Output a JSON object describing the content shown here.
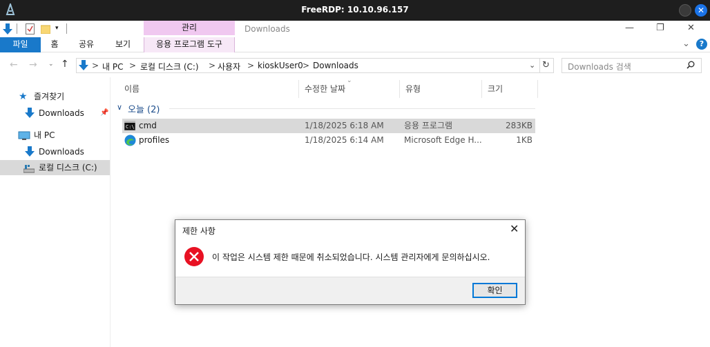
{
  "rdp": {
    "title": "FreeRDP: 10.10.96.157",
    "logo_icon": "freerdp-logo-icon"
  },
  "window": {
    "title": "Downloads",
    "context_group": "관리",
    "ribbon_tabs": [
      "파일",
      "홈",
      "공유",
      "보기",
      "응용 프로그램 도구"
    ],
    "minimize_glyph": "—",
    "maximize_glyph": "❐",
    "close_glyph": "✕",
    "expand_glyph": "⌄",
    "help_glyph": "?"
  },
  "address": {
    "path": [
      "내 PC",
      "로컬 디스크 (C:)",
      "사용자",
      "kioskUser0",
      "Downloads"
    ],
    "separator": ">",
    "search_placeholder": "Downloads 검색"
  },
  "nav": {
    "favorites": "즐겨찾기",
    "fav_downloads": "Downloads",
    "this_pc": "내 PC",
    "pc_downloads": "Downloads",
    "local_disk": "로컬 디스크 (C:)"
  },
  "columns": {
    "name": "이름",
    "modified": "수정한 날짜",
    "type": "유형",
    "size": "크기"
  },
  "group": {
    "label": "오늘 (2)"
  },
  "files": [
    {
      "name": "cmd",
      "modified": "1/18/2025 6:18 AM",
      "type": "응용 프로그램",
      "size": "283KB",
      "icon": "cmd-icon"
    },
    {
      "name": "profiles",
      "modified": "1/18/2025 6:14 AM",
      "type": "Microsoft Edge H...",
      "size": "1KB",
      "icon": "edge-icon"
    }
  ],
  "dialog": {
    "title": "제한 사항",
    "message": "이 작업은 시스템 제한 때문에 취소되었습니다. 시스템 관리자에게 문의하십시오.",
    "ok": "확인"
  }
}
